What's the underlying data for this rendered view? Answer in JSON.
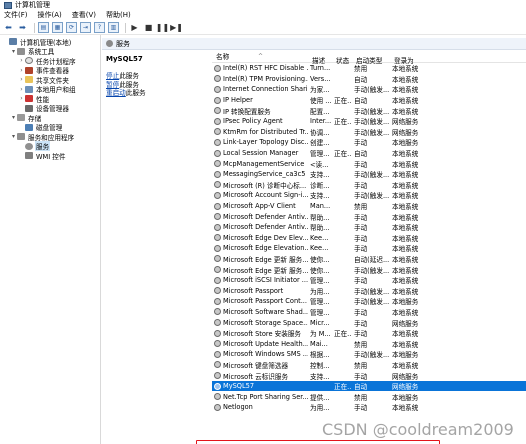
{
  "window": {
    "title": "计算机管理"
  },
  "menu": [
    "文件(F)",
    "操作(A)",
    "查看(V)",
    "帮助(H)"
  ],
  "tree": [
    {
      "label": "计算机管理(本地)",
      "level": 0,
      "toggle": "",
      "icon": "computer-icon"
    },
    {
      "label": "系统工具",
      "level": 1,
      "toggle": "▾",
      "icon": "tools-icon"
    },
    {
      "label": "任务计划程序",
      "level": 2,
      "toggle": "›",
      "icon": "clock-icon"
    },
    {
      "label": "事件查看器",
      "level": 2,
      "toggle": "›",
      "icon": "event-viewer-icon"
    },
    {
      "label": "共享文件夹",
      "level": 2,
      "toggle": "›",
      "icon": "folder-icon"
    },
    {
      "label": "本地用户和组",
      "level": 2,
      "toggle": "›",
      "icon": "users-icon"
    },
    {
      "label": "性能",
      "level": 2,
      "toggle": "›",
      "icon": "performance-icon"
    },
    {
      "label": "设备管理器",
      "level": 2,
      "toggle": "",
      "icon": "device-manager-icon"
    },
    {
      "label": "存储",
      "level": 1,
      "toggle": "▾",
      "icon": "storage-icon"
    },
    {
      "label": "磁盘管理",
      "level": 2,
      "toggle": "",
      "icon": "disk-icon"
    },
    {
      "label": "服务和应用程序",
      "level": 1,
      "toggle": "▾",
      "icon": "apps-icon"
    },
    {
      "label": "服务",
      "level": 2,
      "toggle": "",
      "icon": "services-icon",
      "selected": true
    },
    {
      "label": "WMI 控件",
      "level": 2,
      "toggle": "",
      "icon": "wmi-icon"
    }
  ],
  "content": {
    "header": "服务",
    "extended": {
      "title": "MySQL57",
      "links": [
        {
          "link": "停止",
          "rest": "此服务"
        },
        {
          "link": "暂停",
          "rest": "此服务"
        },
        {
          "link": "重启动",
          "rest": "此服务"
        }
      ]
    },
    "columns": [
      "名称",
      "描述",
      "状态",
      "启动类型",
      "登录为"
    ],
    "services": [
      {
        "name": "Intel(R) RST HFC Disable ...",
        "desc": "Turn...",
        "status": "",
        "start": "禁用",
        "logon": "本地系统"
      },
      {
        "name": "Intel(R) TPM Provisioning...",
        "desc": "Vers...",
        "status": "",
        "start": "自动",
        "logon": "本地系统"
      },
      {
        "name": "Internet Connection Shari...",
        "desc": "为家...",
        "status": "",
        "start": "手动(触发...",
        "logon": "本地系统"
      },
      {
        "name": "IP Helper",
        "desc": "使用 ...",
        "status": "正在...",
        "start": "自动",
        "logon": "本地系统"
      },
      {
        "name": "IP 转换配置服务",
        "desc": "配置...",
        "status": "",
        "start": "手动(触发...",
        "logon": "本地系统"
      },
      {
        "name": "IPsec Policy Agent",
        "desc": "Inter...",
        "status": "正在...",
        "start": "手动(触发...",
        "logon": "网络服务"
      },
      {
        "name": "KtmRm for Distributed Tr...",
        "desc": "协调...",
        "status": "",
        "start": "手动(触发...",
        "logon": "网络服务"
      },
      {
        "name": "Link-Layer Topology Disc...",
        "desc": "创建...",
        "status": "",
        "start": "手动",
        "logon": "本地服务"
      },
      {
        "name": "Local Session Manager",
        "desc": "管理...",
        "status": "正在...",
        "start": "自动",
        "logon": "本地系统"
      },
      {
        "name": "McpManagementService",
        "desc": "<读...",
        "status": "",
        "start": "手动",
        "logon": "本地系统"
      },
      {
        "name": "MessagingService_ca3c5",
        "desc": "支持...",
        "status": "",
        "start": "手动(触发...",
        "logon": "本地系统"
      },
      {
        "name": "Microsoft (R) 诊断中心标...",
        "desc": "诊断...",
        "status": "",
        "start": "手动",
        "logon": "本地系统"
      },
      {
        "name": "Microsoft Account Sign-i...",
        "desc": "支持...",
        "status": "",
        "start": "手动(触发...",
        "logon": "本地系统"
      },
      {
        "name": "Microsoft App-V Client",
        "desc": "Man...",
        "status": "",
        "start": "禁用",
        "logon": "本地系统"
      },
      {
        "name": "Microsoft Defender Antiv...",
        "desc": "帮助...",
        "status": "",
        "start": "手动",
        "logon": "本地系统"
      },
      {
        "name": "Microsoft Defender Antiv...",
        "desc": "帮助...",
        "status": "",
        "start": "手动",
        "logon": "本地系统"
      },
      {
        "name": "Microsoft Edge Dev Elev...",
        "desc": "Kee...",
        "status": "",
        "start": "手动",
        "logon": "本地系统"
      },
      {
        "name": "Microsoft Edge Elevation...",
        "desc": "Kee...",
        "status": "",
        "start": "手动",
        "logon": "本地系统"
      },
      {
        "name": "Microsoft Edge 更新 服务...",
        "desc": "使你...",
        "status": "",
        "start": "自动(延迟...",
        "logon": "本地系统"
      },
      {
        "name": "Microsoft Edge 更新 服务...",
        "desc": "使你...",
        "status": "",
        "start": "手动(触发...",
        "logon": "本地系统"
      },
      {
        "name": "Microsoft iSCSI Initiator ...",
        "desc": "管理...",
        "status": "",
        "start": "手动",
        "logon": "本地系统"
      },
      {
        "name": "Microsoft Passport",
        "desc": "为用...",
        "status": "",
        "start": "手动(触发...",
        "logon": "本地系统"
      },
      {
        "name": "Microsoft Passport Cont...",
        "desc": "管理...",
        "status": "",
        "start": "手动(触发...",
        "logon": "本地服务"
      },
      {
        "name": "Microsoft Software Shad...",
        "desc": "管理...",
        "status": "",
        "start": "手动",
        "logon": "本地系统"
      },
      {
        "name": "Microsoft Storage Space...",
        "desc": "Micr...",
        "status": "",
        "start": "手动",
        "logon": "网络服务"
      },
      {
        "name": "Microsoft Store 安装服务",
        "desc": "为 M...",
        "status": "正在...",
        "start": "手动",
        "logon": "本地系统"
      },
      {
        "name": "Microsoft Update Health...",
        "desc": "Mai...",
        "status": "",
        "start": "禁用",
        "logon": "本地系统"
      },
      {
        "name": "Microsoft Windows SMS ...",
        "desc": "根据...",
        "status": "",
        "start": "手动(触发...",
        "logon": "本地服务"
      },
      {
        "name": "Microsoft 键盘筛选器",
        "desc": "控制...",
        "status": "",
        "start": "禁用",
        "logon": "本地系统"
      },
      {
        "name": "Microsoft 云标识服务",
        "desc": "支持...",
        "status": "",
        "start": "手动",
        "logon": "网络服务"
      },
      {
        "name": "MySQL57",
        "desc": "",
        "status": "正在...",
        "start": "自动",
        "logon": "网络服务",
        "selected": true
      },
      {
        "name": "Net.Tcp Port Sharing Ser...",
        "desc": "提供...",
        "status": "",
        "start": "禁用",
        "logon": "本地服务"
      },
      {
        "name": "Netlogon",
        "desc": "为用...",
        "status": "",
        "start": "手动",
        "logon": "本地系统"
      }
    ]
  },
  "watermark": "CSDN @cooldream2009",
  "colors": {
    "selected_row": "#0a74d8",
    "highlight_box": "#e3151c",
    "link": "#0645ad"
  }
}
